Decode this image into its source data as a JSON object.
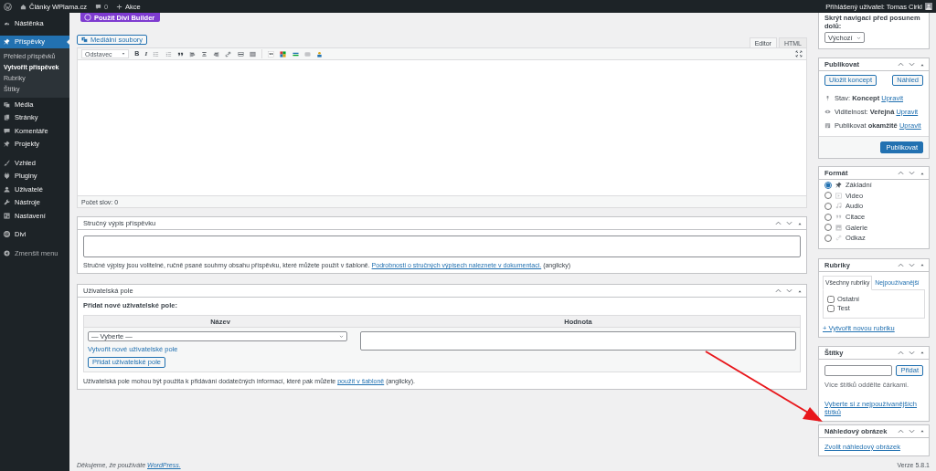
{
  "admin_bar": {
    "site": "Články WPlama.cz",
    "comments": "0",
    "new": "Akce",
    "user": "Přihlášený uživatel: Tomas Cirkl"
  },
  "sidebar": {
    "groups": [
      [
        {
          "label": "Nástěnka",
          "selected": false
        }
      ],
      [
        {
          "label": "Příspěvky",
          "selected": true,
          "children": [
            {
              "label": "Přehled příspěvků",
              "selected": false
            },
            {
              "label": "Vytvořit příspěvek",
              "selected": true
            },
            {
              "label": "Rubriky",
              "selected": false
            },
            {
              "label": "Štítky",
              "selected": false
            }
          ]
        },
        {
          "label": "Média",
          "selected": false
        },
        {
          "label": "Stránky",
          "selected": false
        },
        {
          "label": "Komentáře",
          "selected": false
        },
        {
          "label": "Projekty",
          "selected": false
        }
      ],
      [
        {
          "label": "Vzhled",
          "selected": false
        },
        {
          "label": "Pluginy",
          "selected": false
        },
        {
          "label": "Uživatelé",
          "selected": false
        },
        {
          "label": "Nástroje",
          "selected": false
        },
        {
          "label": "Nastavení",
          "selected": false
        }
      ],
      [
        {
          "label": "Divi",
          "selected": false
        }
      ]
    ],
    "collapse": "Zmenšit menu"
  },
  "divi_button": "Použít Divi Builder",
  "editor": {
    "media_button": "Mediální soubory",
    "tabs": [
      {
        "label": "Editor",
        "selected": true
      },
      {
        "label": "HTML",
        "selected": false
      }
    ],
    "format_select": "Odstavec",
    "bold": "B",
    "italic": "I",
    "word_count": "Počet slov: 0"
  },
  "excerpt": {
    "title": "Stručný výpis příspěvku",
    "help": "Stručné výpisy jsou volitelné, ručně psané souhrny obsahu příspěvku, které můžete použít v šabloně.",
    "link": "Podrobnosti o stručných výpisech naleznete v dokumentaci.",
    "after": "(anglicky)"
  },
  "custom_fields": {
    "title": "Uživatelská pole",
    "subtitle": "Přidat nové uživatelské pole:",
    "columns": [
      "Název",
      "Hodnota"
    ],
    "select": "— Vyberte —",
    "new_link": "Vytvořit nové uživatelské pole",
    "add_button": "Přidat uživatelské pole",
    "help": "Uživatelská pole mohou být použita k přidávání dodatečných informací, které pak můžete",
    "link": "použít v šabloně",
    "after": "(anglicky)."
  },
  "footer": {
    "thanks": "Děkujeme, že používáte",
    "link": "WordPress.",
    "version": "Verze 5.8.1"
  },
  "screen_options": {
    "label": "Skrýt navigaci před posunem dolů:",
    "select": "Výchozí"
  },
  "publish": {
    "title": "Publikovat",
    "save_draft": "Uložit koncept",
    "preview": "Náhled",
    "rows": [
      {
        "label": "Stav:",
        "value": "Koncept",
        "link": "Upravit"
      },
      {
        "label": "Viditelnost:",
        "value": "Veřejná",
        "link": "Upravit"
      },
      {
        "label": "Publikovat",
        "value": "okamžitě",
        "link": "Upravit"
      }
    ],
    "publish_button": "Publikovat"
  },
  "format": {
    "title": "Formát",
    "options": [
      {
        "label": "Základní",
        "selected": true
      },
      {
        "label": "Video",
        "selected": false
      },
      {
        "label": "Audio",
        "selected": false
      },
      {
        "label": "Citace",
        "selected": false
      },
      {
        "label": "Galerie",
        "selected": false
      },
      {
        "label": "Odkaz",
        "selected": false
      }
    ]
  },
  "categories": {
    "title": "Rubriky",
    "tabs": [
      {
        "label": "Všechny rubriky",
        "selected": true
      },
      {
        "label": "Nejpoužívanější",
        "selected": false
      }
    ],
    "items": [
      {
        "label": "Ostatní",
        "checked": false
      },
      {
        "label": "Test",
        "checked": false
      }
    ],
    "add_link": "+ Vytvořit novou rubriku"
  },
  "tags": {
    "title": "Štítky",
    "add_button": "Přidat",
    "help": "Více štítků oddělte čárkami.",
    "link": "Vyberte si z nejpoužívanějších štítků"
  },
  "featured_image": {
    "title": "Náhledový obrázek",
    "link": "Zvolit náhledový obrázek"
  }
}
